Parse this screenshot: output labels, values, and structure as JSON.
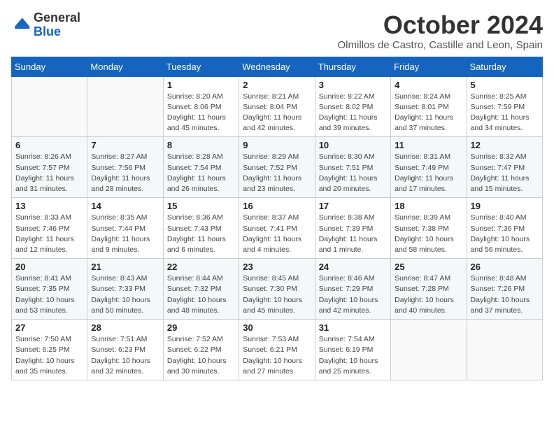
{
  "logo": {
    "general": "General",
    "blue": "Blue"
  },
  "header": {
    "month_title": "October 2024",
    "location": "Olmillos de Castro, Castille and Leon, Spain"
  },
  "weekdays": [
    "Sunday",
    "Monday",
    "Tuesday",
    "Wednesday",
    "Thursday",
    "Friday",
    "Saturday"
  ],
  "weeks": [
    [
      {
        "day": "",
        "info": ""
      },
      {
        "day": "",
        "info": ""
      },
      {
        "day": "1",
        "info": "Sunrise: 8:20 AM\nSunset: 8:06 PM\nDaylight: 11 hours and 45 minutes."
      },
      {
        "day": "2",
        "info": "Sunrise: 8:21 AM\nSunset: 8:04 PM\nDaylight: 11 hours and 42 minutes."
      },
      {
        "day": "3",
        "info": "Sunrise: 8:22 AM\nSunset: 8:02 PM\nDaylight: 11 hours and 39 minutes."
      },
      {
        "day": "4",
        "info": "Sunrise: 8:24 AM\nSunset: 8:01 PM\nDaylight: 11 hours and 37 minutes."
      },
      {
        "day": "5",
        "info": "Sunrise: 8:25 AM\nSunset: 7:59 PM\nDaylight: 11 hours and 34 minutes."
      }
    ],
    [
      {
        "day": "6",
        "info": "Sunrise: 8:26 AM\nSunset: 7:57 PM\nDaylight: 11 hours and 31 minutes."
      },
      {
        "day": "7",
        "info": "Sunrise: 8:27 AM\nSunset: 7:56 PM\nDaylight: 11 hours and 28 minutes."
      },
      {
        "day": "8",
        "info": "Sunrise: 8:28 AM\nSunset: 7:54 PM\nDaylight: 11 hours and 26 minutes."
      },
      {
        "day": "9",
        "info": "Sunrise: 8:29 AM\nSunset: 7:52 PM\nDaylight: 11 hours and 23 minutes."
      },
      {
        "day": "10",
        "info": "Sunrise: 8:30 AM\nSunset: 7:51 PM\nDaylight: 11 hours and 20 minutes."
      },
      {
        "day": "11",
        "info": "Sunrise: 8:31 AM\nSunset: 7:49 PM\nDaylight: 11 hours and 17 minutes."
      },
      {
        "day": "12",
        "info": "Sunrise: 8:32 AM\nSunset: 7:47 PM\nDaylight: 11 hours and 15 minutes."
      }
    ],
    [
      {
        "day": "13",
        "info": "Sunrise: 8:33 AM\nSunset: 7:46 PM\nDaylight: 11 hours and 12 minutes."
      },
      {
        "day": "14",
        "info": "Sunrise: 8:35 AM\nSunset: 7:44 PM\nDaylight: 11 hours and 9 minutes."
      },
      {
        "day": "15",
        "info": "Sunrise: 8:36 AM\nSunset: 7:43 PM\nDaylight: 11 hours and 6 minutes."
      },
      {
        "day": "16",
        "info": "Sunrise: 8:37 AM\nSunset: 7:41 PM\nDaylight: 11 hours and 4 minutes."
      },
      {
        "day": "17",
        "info": "Sunrise: 8:38 AM\nSunset: 7:39 PM\nDaylight: 11 hours and 1 minute."
      },
      {
        "day": "18",
        "info": "Sunrise: 8:39 AM\nSunset: 7:38 PM\nDaylight: 10 hours and 58 minutes."
      },
      {
        "day": "19",
        "info": "Sunrise: 8:40 AM\nSunset: 7:36 PM\nDaylight: 10 hours and 56 minutes."
      }
    ],
    [
      {
        "day": "20",
        "info": "Sunrise: 8:41 AM\nSunset: 7:35 PM\nDaylight: 10 hours and 53 minutes."
      },
      {
        "day": "21",
        "info": "Sunrise: 8:43 AM\nSunset: 7:33 PM\nDaylight: 10 hours and 50 minutes."
      },
      {
        "day": "22",
        "info": "Sunrise: 8:44 AM\nSunset: 7:32 PM\nDaylight: 10 hours and 48 minutes."
      },
      {
        "day": "23",
        "info": "Sunrise: 8:45 AM\nSunset: 7:30 PM\nDaylight: 10 hours and 45 minutes."
      },
      {
        "day": "24",
        "info": "Sunrise: 8:46 AM\nSunset: 7:29 PM\nDaylight: 10 hours and 42 minutes."
      },
      {
        "day": "25",
        "info": "Sunrise: 8:47 AM\nSunset: 7:28 PM\nDaylight: 10 hours and 40 minutes."
      },
      {
        "day": "26",
        "info": "Sunrise: 8:48 AM\nSunset: 7:26 PM\nDaylight: 10 hours and 37 minutes."
      }
    ],
    [
      {
        "day": "27",
        "info": "Sunrise: 7:50 AM\nSunset: 6:25 PM\nDaylight: 10 hours and 35 minutes."
      },
      {
        "day": "28",
        "info": "Sunrise: 7:51 AM\nSunset: 6:23 PM\nDaylight: 10 hours and 32 minutes."
      },
      {
        "day": "29",
        "info": "Sunrise: 7:52 AM\nSunset: 6:22 PM\nDaylight: 10 hours and 30 minutes."
      },
      {
        "day": "30",
        "info": "Sunrise: 7:53 AM\nSunset: 6:21 PM\nDaylight: 10 hours and 27 minutes."
      },
      {
        "day": "31",
        "info": "Sunrise: 7:54 AM\nSunset: 6:19 PM\nDaylight: 10 hours and 25 minutes."
      },
      {
        "day": "",
        "info": ""
      },
      {
        "day": "",
        "info": ""
      }
    ]
  ]
}
